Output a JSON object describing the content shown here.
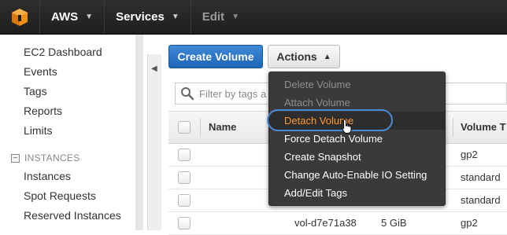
{
  "topbar": {
    "brand": "AWS",
    "services": "Services",
    "edit": "Edit",
    "colors": {
      "background": "#232323",
      "logo": "#f29111"
    }
  },
  "sidebar": {
    "items": [
      "EC2 Dashboard",
      "Events",
      "Tags",
      "Reports",
      "Limits"
    ],
    "section_header": "INSTANCES",
    "instances_items": [
      "Instances",
      "Spot Requests",
      "Reserved Instances"
    ]
  },
  "toolbar": {
    "create_label": "Create Volume",
    "actions_label": "Actions"
  },
  "filter": {
    "placeholder": "Filter by tags a"
  },
  "table": {
    "columns": [
      "Name",
      "Volume T"
    ],
    "rows": [
      {
        "name": "",
        "volume_id": "",
        "size": "",
        "type": "gp2"
      },
      {
        "name": "",
        "volume_id": "",
        "size": "",
        "type": "standard"
      },
      {
        "name": "",
        "volume_id": "",
        "size": "",
        "type": "standard"
      },
      {
        "name": "",
        "volume_id": "vol-d7e71a38",
        "size": "5 GiB",
        "type": "gp2"
      }
    ]
  },
  "actions_menu": {
    "items": [
      {
        "label": "Delete Volume",
        "state": "disabled"
      },
      {
        "label": "Attach Volume",
        "state": "disabled"
      },
      {
        "label": "Detach Volume",
        "state": "hover"
      },
      {
        "label": "Force Detach Volume",
        "state": "enabled"
      },
      {
        "label": "Create Snapshot",
        "state": "enabled"
      },
      {
        "label": "Change Auto-Enable IO Setting",
        "state": "enabled"
      },
      {
        "label": "Add/Edit Tags",
        "state": "enabled"
      }
    ],
    "colors": {
      "background": "#3a3a3a",
      "hover_text": "#ff9933",
      "highlight_ring": "#4a8bd6"
    }
  }
}
